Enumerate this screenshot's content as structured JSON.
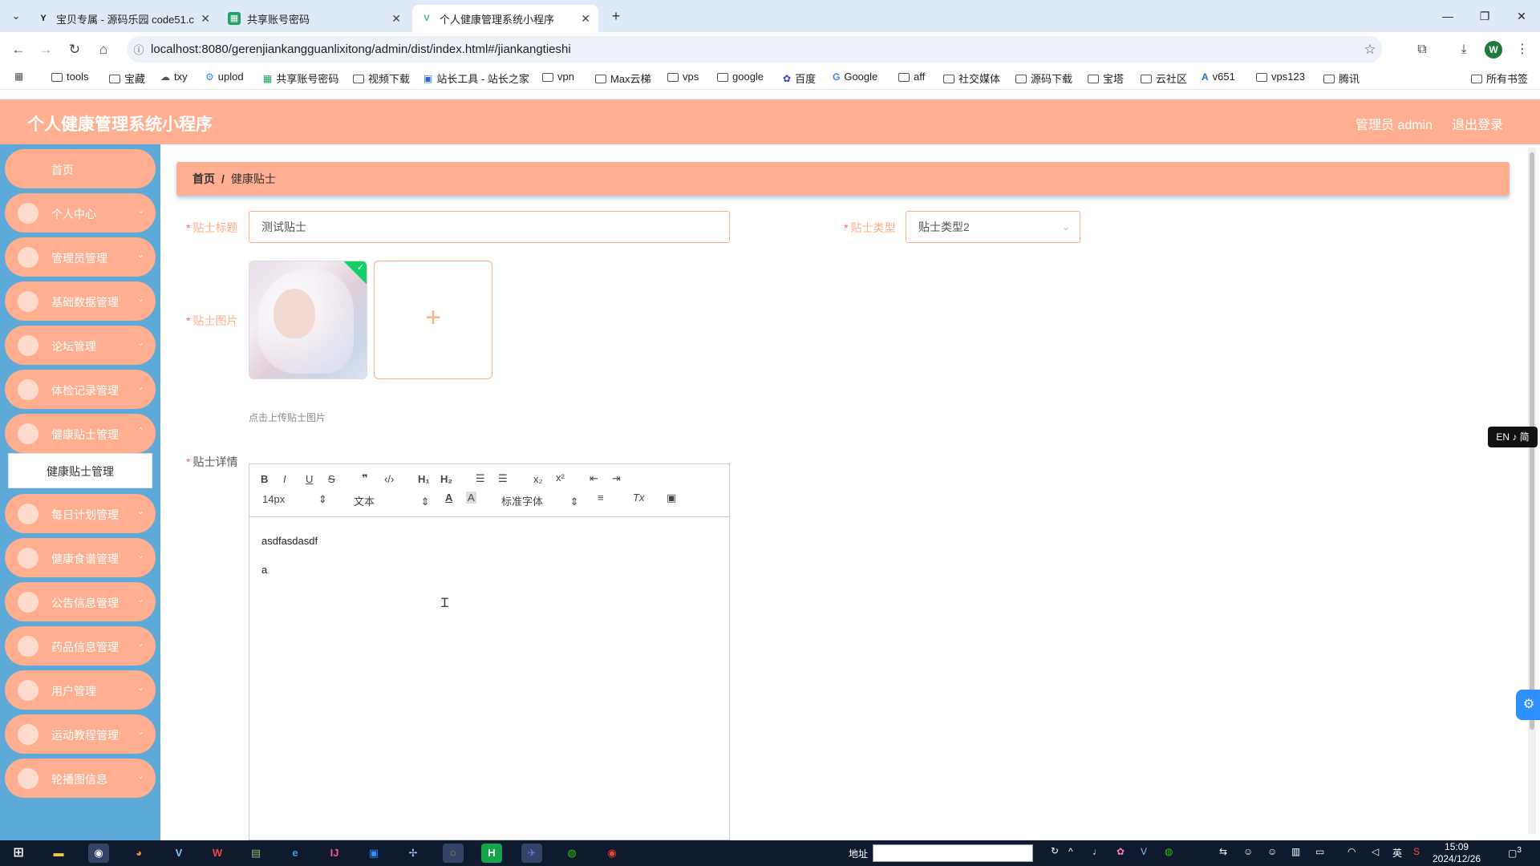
{
  "browser": {
    "tabs": [
      {
        "label": "宝贝专属 - 源码乐园 code51.c",
        "icon": "y-logo-icon"
      },
      {
        "label": "共享账号密码",
        "icon": "sheet-icon"
      },
      {
        "label": "个人健康管理系统小程序",
        "icon": "vue-logo-icon"
      }
    ],
    "url": "localhost:8080/gerenjiankangguanlixitong/admin/dist/index.html#/jiankangtieshi",
    "profile_initial": "W",
    "bookmarks": [
      {
        "label": "tools"
      },
      {
        "label": "宝藏"
      },
      {
        "label": "txy"
      },
      {
        "label": "uplod"
      },
      {
        "label": "共享账号密码"
      },
      {
        "label": "视频下载"
      },
      {
        "label": "站长工具 - 站长之家"
      },
      {
        "label": "vpn"
      },
      {
        "label": "Max云梯"
      },
      {
        "label": "vps"
      },
      {
        "label": "google"
      },
      {
        "label": "百度"
      },
      {
        "label": "Google"
      },
      {
        "label": "aff"
      },
      {
        "label": "社交媒体"
      },
      {
        "label": "源码下载"
      },
      {
        "label": "宝塔"
      },
      {
        "label": "云社区"
      },
      {
        "label": "v651"
      },
      {
        "label": "vps123"
      },
      {
        "label": "腾讯"
      },
      {
        "label": "所有书签"
      }
    ]
  },
  "app": {
    "title": "个人健康管理系统小程序",
    "admin_label": "管理员 admin",
    "logout_label": "退出登录",
    "colors": {
      "accent": "#ffaf90",
      "sidebar": "#5daad8",
      "required": "#f56c6c"
    }
  },
  "sidebar": {
    "items": [
      {
        "label": "首页"
      },
      {
        "label": "个人中心"
      },
      {
        "label": "管理员管理"
      },
      {
        "label": "基础数据管理"
      },
      {
        "label": "论坛管理"
      },
      {
        "label": "体检记录管理"
      },
      {
        "label": "健康贴士管理"
      },
      {
        "label": "每日计划管理"
      },
      {
        "label": "健康食谱管理"
      },
      {
        "label": "公告信息管理"
      },
      {
        "label": "药品信息管理"
      },
      {
        "label": "用户管理"
      },
      {
        "label": "运动教程管理"
      },
      {
        "label": "轮播图信息"
      }
    ],
    "submenu_label": "健康贴士管理"
  },
  "breadcrumb": {
    "home": "首页",
    "sep": "/",
    "current": "健康贴士"
  },
  "form": {
    "title_label": "贴士标题",
    "title_value": "测试贴士",
    "type_label": "贴士类型",
    "type_value": "贴士类型2",
    "image_label": "贴士图片",
    "upload_tip": "点击上传贴士图片",
    "detail_label": "贴士详情",
    "editor": {
      "font_size": "14px",
      "block_format": "文本",
      "font_family": "标准字体",
      "content_lines": [
        "asdfasdasdf",
        "a"
      ]
    }
  },
  "widgets": {
    "ime_toggle": "EN ♪ 简"
  },
  "taskbar": {
    "address_label": "地址",
    "time": "15:09",
    "date": "2024/12/26",
    "notification_count": "3",
    "ime_lang": "英"
  }
}
